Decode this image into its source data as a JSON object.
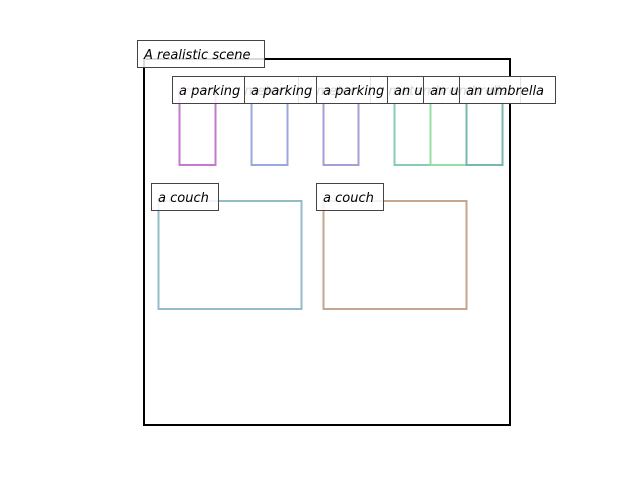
{
  "scene": {
    "title": "A realistic scene",
    "frame_color": "#000000"
  },
  "objects": [
    {
      "label": "a parking meter",
      "color": "#c27bcc"
    },
    {
      "label": "a parking meter",
      "color": "#9aa7de"
    },
    {
      "label": "a parking meter",
      "color": "#a59fd6"
    },
    {
      "label": "an umbrella",
      "color": "#88cdb0"
    },
    {
      "label": "an umbrella",
      "color": "#99dca6"
    },
    {
      "label": "an umbrella",
      "color": "#79b6ae"
    },
    {
      "label": "a couch",
      "color": "#93bcc6"
    },
    {
      "label": "a couch",
      "color": "#c6a68e"
    }
  ]
}
